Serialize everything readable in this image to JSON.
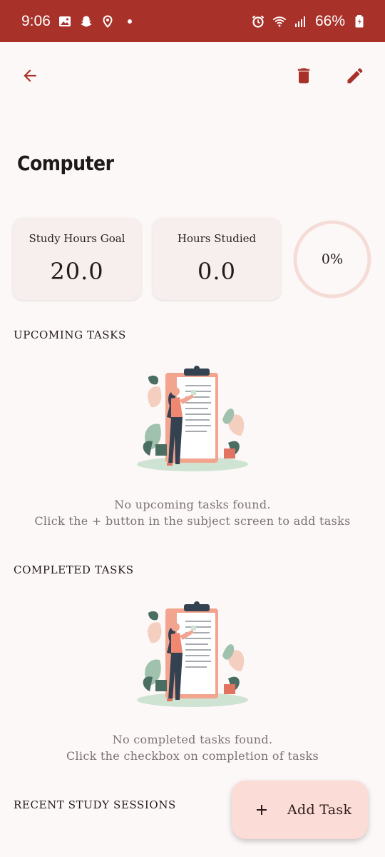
{
  "status_bar": {
    "time": "9:06",
    "battery": "66%"
  },
  "top_bar": {
    "back_icon": "arrow-left-icon",
    "delete_icon": "trash-icon",
    "edit_icon": "pencil-icon"
  },
  "subject": {
    "name": "Computer"
  },
  "stats": {
    "goal_label": "Study Hours Goal",
    "goal_value": "20.0",
    "studied_label": "Hours Studied",
    "studied_value": "0.0",
    "progress_text": "0%",
    "progress_fraction": 0.0
  },
  "upcoming": {
    "title": "UPCOMING TASKS",
    "empty_line1": "No upcoming tasks found.",
    "empty_line2": "Click the + button in the subject screen to add tasks"
  },
  "completed": {
    "title": "COMPLETED TASKS",
    "empty_line1": "No completed tasks found.",
    "empty_line2": "Click the checkbox on completion of tasks"
  },
  "sessions": {
    "title": "RECENT STUDY SESSIONS"
  },
  "fab": {
    "label": "Add Task",
    "icon": "plus-icon"
  },
  "colors": {
    "status_bar": "#a8322a",
    "accent": "#a8322a",
    "card_bg": "#f7eeee",
    "fab_bg": "#fcdcd6",
    "progress_track": "#f5dcd6"
  }
}
